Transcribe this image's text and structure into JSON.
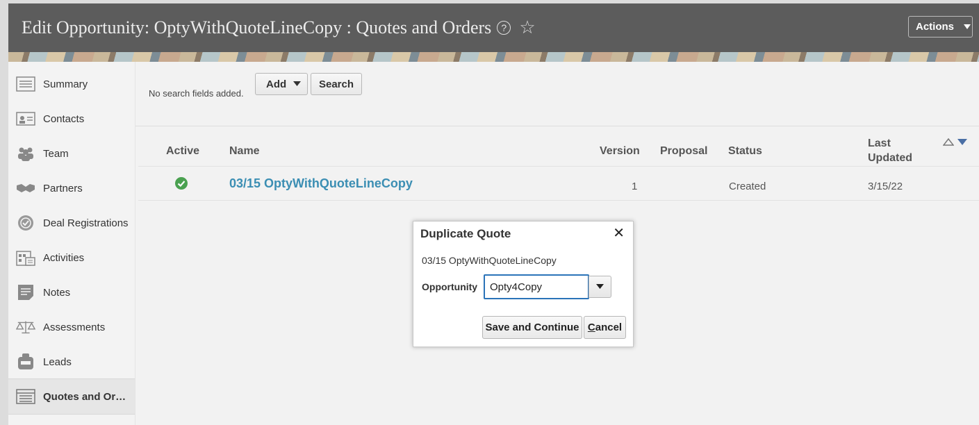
{
  "header": {
    "title": "Edit Opportunity: OptyWithQuoteLineCopy : Quotes and Orders",
    "actions_label": "Actions"
  },
  "sidebar": {
    "items": [
      {
        "label": "Summary",
        "icon": "summary-icon"
      },
      {
        "label": "Contacts",
        "icon": "contacts-icon"
      },
      {
        "label": "Team",
        "icon": "team-icon"
      },
      {
        "label": "Partners",
        "icon": "partners-icon"
      },
      {
        "label": "Deal Registrations",
        "icon": "deal-registrations-icon"
      },
      {
        "label": "Activities",
        "icon": "activities-icon"
      },
      {
        "label": "Notes",
        "icon": "notes-icon"
      },
      {
        "label": "Assessments",
        "icon": "assessments-icon"
      },
      {
        "label": "Leads",
        "icon": "leads-icon"
      },
      {
        "label": "Quotes and Or…",
        "icon": "quotes-icon",
        "active": true
      }
    ]
  },
  "search": {
    "no_fields_text": "No search fields added.",
    "add_label": "Add",
    "search_label": "Search"
  },
  "table": {
    "headers": {
      "active": "Active",
      "name": "Name",
      "version": "Version",
      "proposal": "Proposal",
      "status": "Status",
      "last_updated": "Last Updated"
    },
    "rows": [
      {
        "active": true,
        "name": "03/15 OptyWithQuoteLineCopy",
        "version": "1",
        "proposal": "",
        "status": "Created",
        "last_updated": "3/15/22"
      }
    ]
  },
  "dialog": {
    "title": "Duplicate Quote",
    "quote_name": "03/15 OptyWithQuoteLineCopy",
    "opportunity_label": "Opportunity",
    "opportunity_value": "Opty4Copy",
    "save_label": "Save and Continue",
    "cancel_label": "Cancel"
  },
  "colors": {
    "header_bg": "#5c5c5c",
    "link": "#3b8eb3",
    "active_check": "#4aa150",
    "focus_border": "#2a73b8"
  }
}
